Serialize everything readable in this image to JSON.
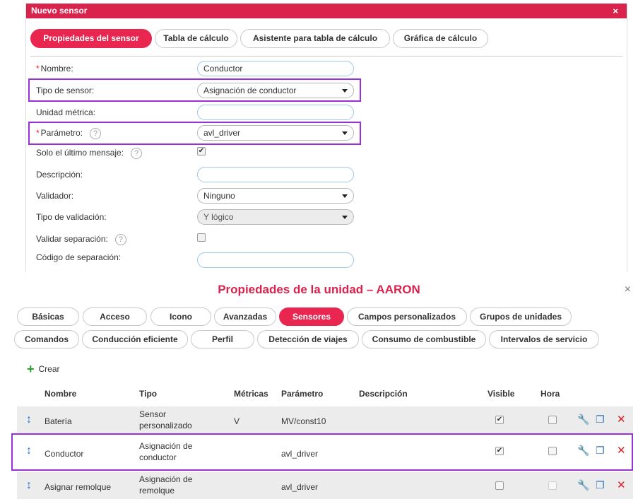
{
  "sensor_dialog": {
    "title": "Nuevo sensor",
    "close": "×",
    "tabs": [
      "Propiedades del sensor",
      "Tabla de cálculo",
      "Asistente para tabla de cálculo",
      "Gráfica de cálculo"
    ],
    "required_mark": "*",
    "help_glyph": "?",
    "fields": {
      "nombre": {
        "label": "Nombre:",
        "value": "Conductor"
      },
      "tipo_sensor": {
        "label": "Tipo de sensor:",
        "value": "Asignación de conductor"
      },
      "unidad_metrica": {
        "label": "Unidad métrica:",
        "value": ""
      },
      "parametro": {
        "label": "Parámetro:",
        "value": "avl_driver"
      },
      "solo_ultimo": {
        "label": "Solo el último mensaje:",
        "checked": true
      },
      "descripcion": {
        "label": "Descripción:",
        "value": ""
      },
      "validador": {
        "label": "Validador:",
        "value": "Ninguno"
      },
      "tipo_validacion": {
        "label": "Tipo de validación:",
        "value": "Y lógico"
      },
      "validar_separacion": {
        "label": "Validar separación:",
        "checked": false
      },
      "codigo_separacion": {
        "label": "Código de separación:",
        "value": ""
      }
    }
  },
  "unit_dialog": {
    "title": "Propiedades de la unidad – AARON",
    "close": "×",
    "tabs_row1": [
      "Básicas",
      "Acceso",
      "Icono",
      "Avanzadas",
      "Sensores",
      "Campos personalizados",
      "Grupos de unidades"
    ],
    "tabs_row2": [
      "Comandos",
      "Conducción eficiente",
      "Perfil",
      "Detección de viajes",
      "Consumo de combustible",
      "Intervalos de servicio"
    ],
    "active_tab": "Sensores",
    "create_label": "Crear",
    "columns": [
      "Nombre",
      "Tipo",
      "Métricas",
      "Parámetro",
      "Descripción",
      "Visible",
      "Hora"
    ],
    "rows": [
      {
        "name": "Batería",
        "type_line1": "Sensor",
        "type_line2": "personalizado",
        "metric": "V",
        "param": "MV/const10",
        "description": "",
        "visible": true,
        "hora": false
      },
      {
        "name": "Conductor",
        "type_line1": "Asignación de",
        "type_line2": "conductor",
        "metric": "",
        "param": "avl_driver",
        "description": "",
        "visible": true,
        "hora": false
      },
      {
        "name": "Asignar remolque",
        "type_line1": "Asignación de",
        "type_line2": "remolque",
        "metric": "",
        "param": "avl_driver",
        "description": "",
        "visible": false,
        "hora": false
      }
    ]
  },
  "colors": {
    "accent": "#d8234d",
    "highlight": "#9b30d9",
    "drag": "#2a7bd0",
    "delete": "#e0191f"
  }
}
